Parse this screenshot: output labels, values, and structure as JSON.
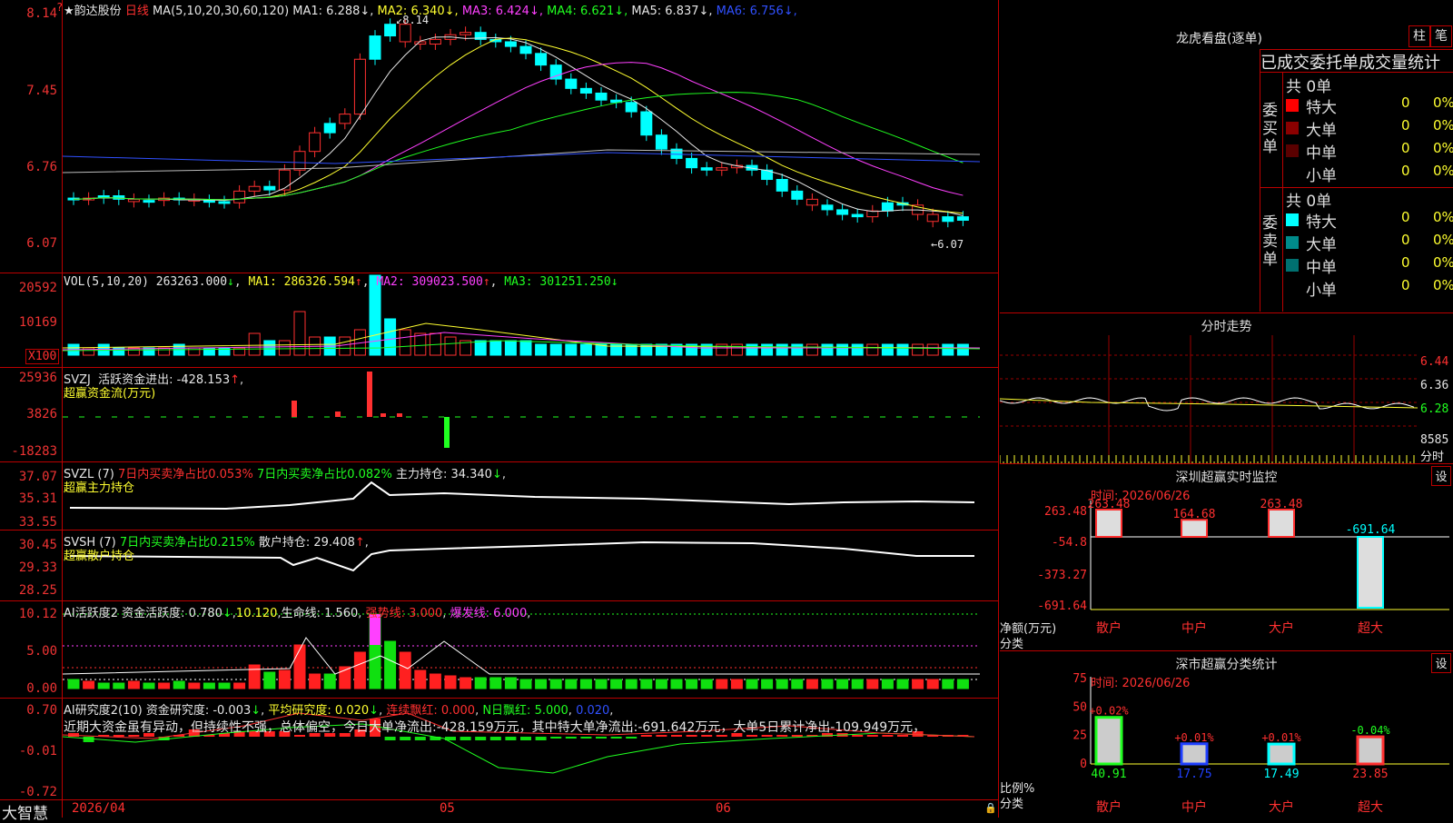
{
  "stock": {
    "name": "韵达股份",
    "period": "日线",
    "ma_label": "MA(5,10,20,30,60,120)"
  },
  "main_legend": [
    {
      "label": "MA1: 6.288",
      "color": "#e6e6e6"
    },
    {
      "label": "MA2: 6.340",
      "color": "#ffff30"
    },
    {
      "label": "MA3: 6.424",
      "color": "#ff40ff"
    },
    {
      "label": "MA4: 6.621",
      "color": "#20ff20"
    },
    {
      "label": "MA5: 6.837",
      "color": "#e6e6e6"
    },
    {
      "label": "MA6: 6.756",
      "color": "#3050ff"
    }
  ],
  "main_yticks": [
    "8.14",
    "7.45",
    "6.76",
    "6.07"
  ],
  "main_high_label": "8.14",
  "main_low_label": "6.07",
  "vol_legend": {
    "head": "VOL(5,10,20)",
    "value": "263263.000",
    "ma1": "MA1: 286326.594",
    "ma2": "MA2: 309023.500",
    "ma3": "MA3: 301251.250"
  },
  "vol_yticks": [
    "20592",
    "10169"
  ],
  "vol_unit": "X100",
  "svzj": {
    "head": "SVZJ",
    "title": "活跃资金进出: -428.153",
    "sub": "超赢资金流(万元)",
    "yticks": [
      "25936",
      "3826",
      "-18283"
    ]
  },
  "svzl": {
    "head": "SVZL (7)",
    "a": "7日内买卖净占比0.053%",
    "b": "7日内买卖净占比0.082%",
    "c": "主力持仓: 34.340",
    "sub": "超赢主力持仓",
    "yticks": [
      "37.07",
      "35.31",
      "33.55"
    ]
  },
  "svsh": {
    "head": "SVSH (7)",
    "a": "7日内买卖净占比0.215%",
    "c": "散户持仓: 29.408",
    "sub": "超赢散户持仓",
    "yticks": [
      "30.45",
      "29.33",
      "28.25"
    ]
  },
  "ai1": {
    "head": "AI活跃度2",
    "a": "资金活跃度: 0.780",
    "b": "10.120",
    "c": "生命线: 1.560",
    "d": "强势线: 3.000",
    "e": "爆发线: 6.000",
    "yticks": [
      "10.12",
      "5.00",
      "0.00"
    ]
  },
  "ai2": {
    "head": "AI研究度2(10)",
    "a": "资金研究度: -0.003",
    "b": "平均研究度: 0.020",
    "c": "连续飘红: 0.000",
    "d": "N日飘红: 5.000",
    "e": "0.020",
    "note": "近期大资金虽有异动，但持续性不强，总体偏空，今日大单净流出:-428.159万元，其中特大单净流出:-691.642万元，大单5日累计净出-109.949万元，",
    "yticks": [
      "0.70",
      "-0.01",
      "-0.72"
    ]
  },
  "x_axis": {
    "labels": [
      "2026/04",
      "05",
      "06"
    ],
    "brand": "大智慧"
  },
  "lhb": {
    "title": "龙虎看盘(逐单)",
    "btn1": "柱",
    "btn2": "笔",
    "tabs": "已成交委托单成交量统计",
    "buy": {
      "side": "委买单",
      "total": "共 0单",
      "rows": [
        {
          "label": "特大",
          "count": "0",
          "pct": "0%",
          "color": "#ff0000"
        },
        {
          "label": "大单",
          "count": "0",
          "pct": "0%",
          "color": "#8b0000"
        },
        {
          "label": "中单",
          "count": "0",
          "pct": "0%",
          "color": "#5a0000"
        },
        {
          "label": "小单",
          "count": "0",
          "pct": "0%",
          "color": "#000000"
        }
      ]
    },
    "sell": {
      "side": "委卖单",
      "total": "共 0单",
      "rows": [
        {
          "label": "特大",
          "count": "0",
          "pct": "0%",
          "color": "#00ffff"
        },
        {
          "label": "大单",
          "count": "0",
          "pct": "0%",
          "color": "#008b8b"
        },
        {
          "label": "中单",
          "count": "0",
          "pct": "0%",
          "color": "#007070"
        },
        {
          "label": "小单",
          "count": "0",
          "pct": "0%",
          "color": "#000000"
        }
      ]
    }
  },
  "intraday": {
    "title": "分时走势",
    "yticks": [
      "6.44",
      "6.36",
      "6.28",
      "8585"
    ],
    "unit": "分时"
  },
  "monitor": {
    "title": "深圳超赢实时监控",
    "date": "时间: 2026/06/26",
    "btn": "设",
    "yticks": [
      "263.48",
      "-54.8",
      "-373.27",
      "-691.64"
    ],
    "ylabel": "净额(万元)",
    "xlabel": "分类",
    "categories": [
      "散户",
      "中户",
      "大户",
      "超大"
    ],
    "values": [
      263.48,
      164.68,
      263.48,
      -691.64
    ],
    "value_labels": [
      "263.48",
      "164.68",
      "263.48",
      "-691.64"
    ]
  },
  "classify": {
    "title": "深市超赢分类统计",
    "date": "时间: 2026/06/26",
    "btn": "设",
    "yticks": [
      "75",
      "50",
      "25",
      "0"
    ],
    "ylabel": "比例%",
    "xlabel": "分类",
    "categories": [
      "散户",
      "中户",
      "大户",
      "超大"
    ],
    "values": [
      40.91,
      17.75,
      17.49,
      23.85
    ],
    "changes": [
      "+0.02%",
      "+0.01%",
      "+0.01%",
      "-0.04%"
    ]
  }
}
